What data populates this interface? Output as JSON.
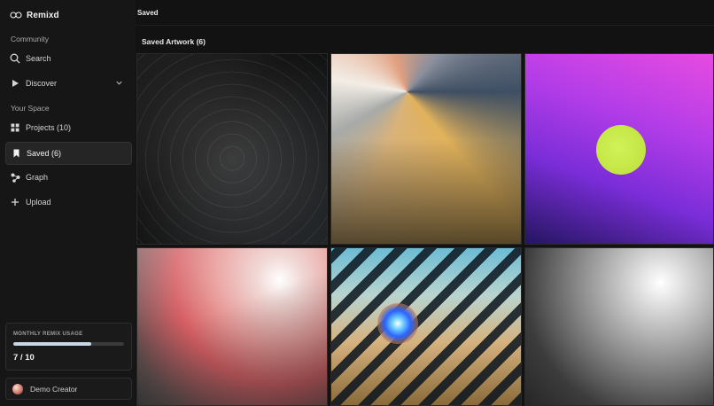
{
  "app": {
    "name": "Remixd"
  },
  "sidebar": {
    "community_label": "Community",
    "community_items": [
      {
        "label": "Search",
        "icon": "search-icon"
      },
      {
        "label": "Discover",
        "icon": "play-icon"
      }
    ],
    "space_label": "Your Space",
    "space_items": [
      {
        "label": "Projects (10)",
        "icon": "grid-icon"
      },
      {
        "label": "Saved (6)",
        "icon": "bookmark-icon"
      },
      {
        "label": "Graph",
        "icon": "graph-icon"
      },
      {
        "label": "Upload",
        "icon": "plus-icon"
      }
    ],
    "usage": {
      "title": "MONTHLY REMIX USAGE",
      "used": 7,
      "limit": 10,
      "count_text": "7 / 10"
    },
    "user": {
      "name": "Demo Creator"
    }
  },
  "main": {
    "breadcrumb": "Saved",
    "section_title": "Saved Artwork (6)",
    "artworks": [
      {
        "style": "dark-concentric-rings"
      },
      {
        "style": "conic-pastel-gradient"
      },
      {
        "style": "magenta-purple-with-lime-circle"
      },
      {
        "style": "pink-red-radial-glow"
      },
      {
        "style": "diagonal-stripes-with-blue-orb"
      },
      {
        "style": "grey-radial-glow"
      }
    ]
  },
  "colors": {
    "sidebar_bg": "#161616",
    "main_bg": "#121212",
    "accent_usage": "#c9d6e6"
  }
}
